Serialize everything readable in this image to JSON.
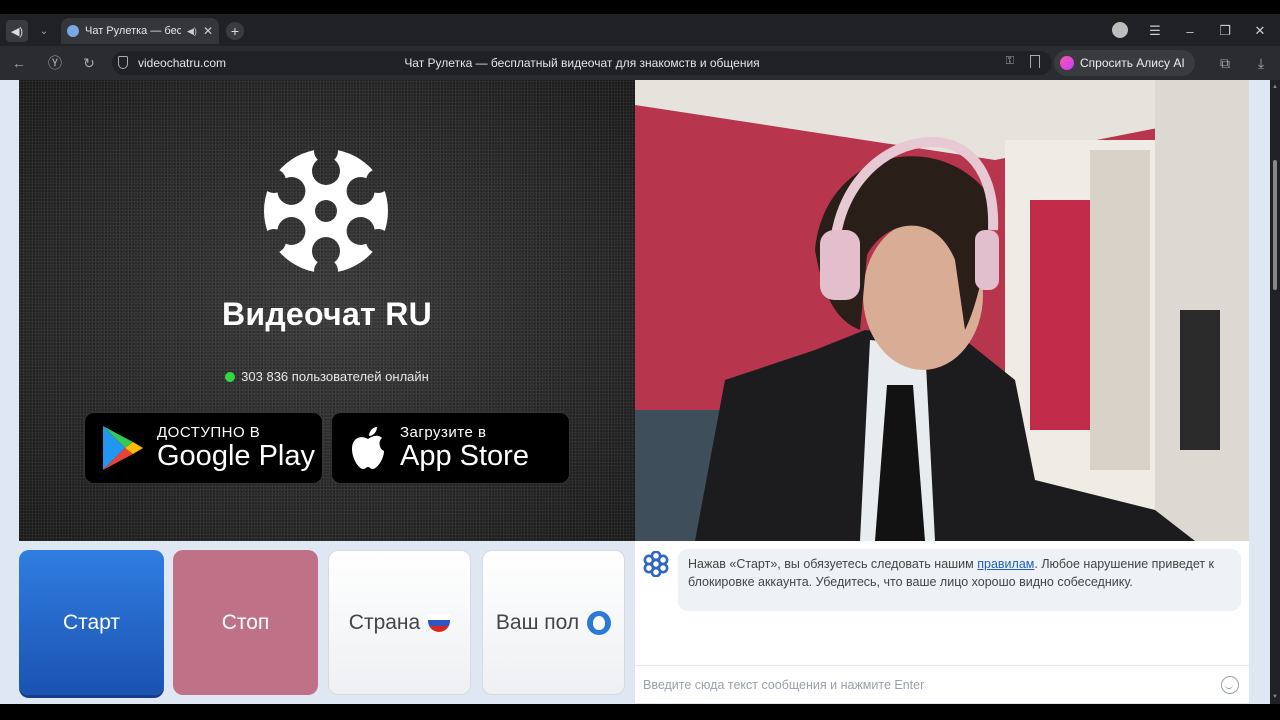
{
  "browser": {
    "tab_title": "Чат Рулетка — бесп",
    "address": "videochatru.com",
    "page_title": "Чат Рулетка — бесплатный видеочат для знакомств и общения",
    "alice_label": "Спросить Алису AI"
  },
  "hero": {
    "brand": "Видеочат RU",
    "online_text": "303 836 пользователей онлайн",
    "google_play": {
      "small": "ДОСТУПНО В",
      "big": "Google Play"
    },
    "app_store": {
      "small": "Загрузите в",
      "big": "App Store"
    }
  },
  "controls": {
    "start": "Старт",
    "stop": "Стоп",
    "country": "Страна",
    "gender": "Ваш пол"
  },
  "chat": {
    "message_before": "Нажав «Старт», вы обязуетесь следовать нашим ",
    "message_link": "правилам",
    "message_after": ". Любое нарушение приведет к блокировке аккаунта. Убедитесь, что ваше лицо хорошо видно собеседнику.",
    "input_placeholder": "Введите сюда текст сообщения и нажмите Enter"
  },
  "colors": {
    "start": "#1b52b2",
    "stop": "#bf7287",
    "online_dot": "#31d843",
    "link": "#1e5fc2"
  }
}
